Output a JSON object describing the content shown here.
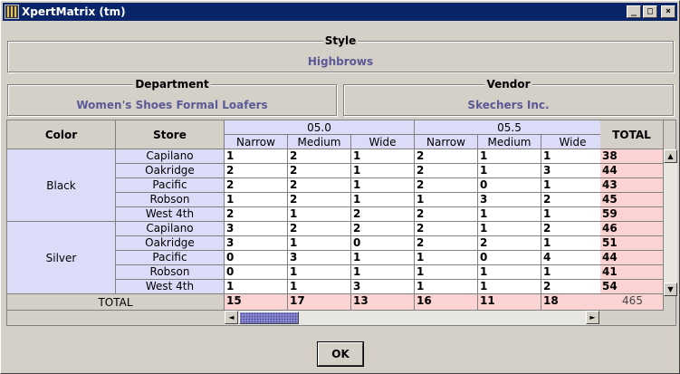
{
  "window": {
    "title": "XpertMatrix (tm)",
    "minimize": "_",
    "maximize": "□",
    "close": "×"
  },
  "style": {
    "label": "Style",
    "value": "Highbrows"
  },
  "department": {
    "label": "Department",
    "value": "Women's Shoes Formal Loafers"
  },
  "vendor": {
    "label": "Vendor",
    "value": "Skechers Inc."
  },
  "grid": {
    "color_header": "Color",
    "store_header": "Store",
    "total_header": "TOTAL",
    "size_groups": [
      "05.0",
      "05.5"
    ],
    "widths": [
      "Narrow",
      "Medium",
      "Wide"
    ],
    "colors": [
      {
        "name": "Black",
        "rows": [
          {
            "store": "Capilano",
            "values": [
              "1",
              "2",
              "1",
              "2",
              "1",
              "1"
            ],
            "total": "38"
          },
          {
            "store": "Oakridge",
            "values": [
              "2",
              "2",
              "1",
              "2",
              "1",
              "3"
            ],
            "total": "44"
          },
          {
            "store": "Pacific",
            "values": [
              "2",
              "2",
              "1",
              "2",
              "0",
              "1"
            ],
            "total": "43"
          },
          {
            "store": "Robson",
            "values": [
              "1",
              "2",
              "1",
              "1",
              "3",
              "2"
            ],
            "total": "45"
          },
          {
            "store": "West 4th",
            "values": [
              "2",
              "1",
              "2",
              "2",
              "1",
              "1"
            ],
            "total": "59"
          }
        ]
      },
      {
        "name": "Silver",
        "rows": [
          {
            "store": "Capilano",
            "values": [
              "3",
              "2",
              "2",
              "2",
              "1",
              "2"
            ],
            "total": "46"
          },
          {
            "store": "Oakridge",
            "values": [
              "3",
              "1",
              "0",
              "2",
              "2",
              "1"
            ],
            "total": "51"
          },
          {
            "store": "Pacific",
            "values": [
              "0",
              "3",
              "1",
              "1",
              "0",
              "4"
            ],
            "total": "44"
          },
          {
            "store": "Robson",
            "values": [
              "0",
              "1",
              "1",
              "1",
              "1",
              "1"
            ],
            "total": "41"
          },
          {
            "store": "West 4th",
            "values": [
              "1",
              "1",
              "3",
              "1",
              "1",
              "2"
            ],
            "total": "54"
          }
        ]
      }
    ],
    "totals_label": "TOTAL",
    "column_totals": [
      "15",
      "17",
      "13",
      "16",
      "11",
      "18"
    ],
    "grand_total": "465"
  },
  "scroll": {
    "up": "▲",
    "down": "▼",
    "left": "◄",
    "right": "►"
  },
  "ok_label": "OK"
}
